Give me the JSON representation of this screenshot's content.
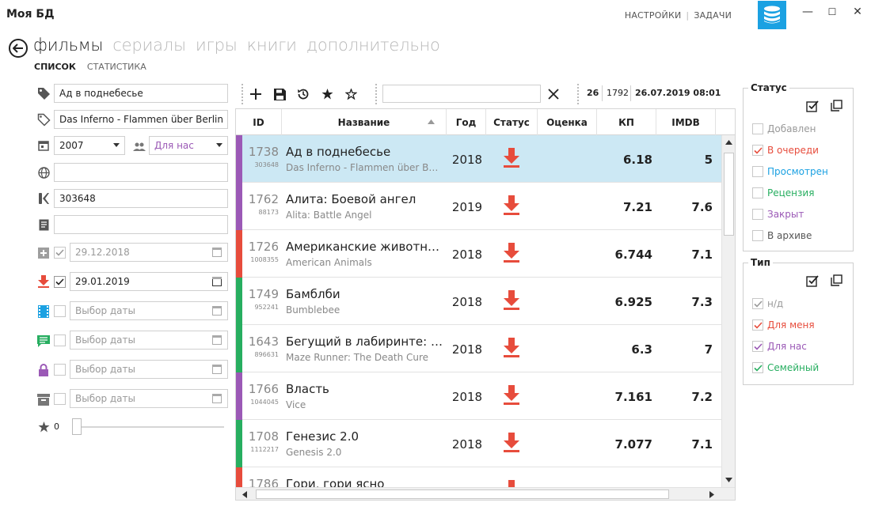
{
  "window": {
    "title": "Моя БД",
    "minimize": "—",
    "maximize": "☐",
    "close": "✕"
  },
  "top_links": {
    "settings": "НАСТРОЙКИ",
    "separator": "|",
    "tasks": "ЗАДАЧИ"
  },
  "nav": {
    "tabs": [
      {
        "label": "фильмы",
        "active": true
      },
      {
        "label": "сериалы",
        "active": false
      },
      {
        "label": "игры",
        "active": false
      },
      {
        "label": "книги",
        "active": false
      },
      {
        "label": "дополнительно",
        "active": false
      }
    ],
    "sub_tabs": [
      {
        "label": "СПИСОК",
        "active": true
      },
      {
        "label": "СТАТИСТИКА",
        "active": false
      }
    ]
  },
  "form": {
    "title_ru": "Ад в поднебесье",
    "title_orig": "Das Inferno - Flammen über Berlin",
    "year": "2007",
    "audience": "Для нас",
    "website": "",
    "kp_id": "303648",
    "notes": "",
    "date_added": "29.12.2018",
    "date_queued": "29.01.2019",
    "date_watched_placeholder": "Выбор даты",
    "date_review_placeholder": "Выбор даты",
    "date_closed_placeholder": "Выбор даты",
    "date_archived_placeholder": "Выбор даты",
    "rating": "0"
  },
  "toolbar": {
    "search_value": "",
    "count_selected": "26",
    "count_total": "1792",
    "last_update": "26.07.2019 08:01"
  },
  "grid": {
    "columns": [
      "ID",
      "Название",
      "Год",
      "Статус",
      "Оценка",
      "КП",
      "IMDB"
    ],
    "rows": [
      {
        "id": "1738",
        "kp_id": "303648",
        "title": "Ад в поднебесье",
        "original": "Das Inferno - Flammen über Berlin",
        "year": "2018",
        "status": "в очереди",
        "rating": "",
        "kp": "6.18",
        "imdb": "5",
        "type_color": "#9b59b6",
        "selected": true
      },
      {
        "id": "1762",
        "kp_id": "88173",
        "title": "Алита: Боевой ангел",
        "original": "Alita: Battle Angel",
        "year": "2019",
        "status": "в очереди",
        "rating": "",
        "kp": "7.21",
        "imdb": "7.6",
        "type_color": "#9b59b6",
        "selected": false
      },
      {
        "id": "1726",
        "kp_id": "1008355",
        "title": "Американские животные",
        "original": "American Animals",
        "year": "2018",
        "status": "в очереди",
        "rating": "",
        "kp": "6.744",
        "imdb": "7.1",
        "type_color": "#e74c3c",
        "selected": false
      },
      {
        "id": "1749",
        "kp_id": "952241",
        "title": "Бамблби",
        "original": "Bumblebee",
        "year": "2018",
        "status": "в очереди",
        "rating": "",
        "kp": "6.925",
        "imdb": "7.3",
        "type_color": "#27ae60",
        "selected": false
      },
      {
        "id": "1643",
        "kp_id": "896631",
        "title": "Бегущий в лабиринте: Лекарство от смерти",
        "original": "Maze Runner: The Death Cure",
        "year": "2018",
        "status": "в очереди",
        "rating": "",
        "kp": "6.3",
        "imdb": "7",
        "type_color": "#27ae60",
        "selected": false
      },
      {
        "id": "1766",
        "kp_id": "1044045",
        "title": "Власть",
        "original": "Vice",
        "year": "2018",
        "status": "в очереди",
        "rating": "",
        "kp": "7.161",
        "imdb": "7.2",
        "type_color": "#9b59b6",
        "selected": false
      },
      {
        "id": "1708",
        "kp_id": "1112217",
        "title": "Генезис 2.0",
        "original": "Genesis 2.0",
        "year": "2018",
        "status": "в очереди",
        "rating": "",
        "kp": "7.077",
        "imdb": "7.1",
        "type_color": "#27ae60",
        "selected": false
      },
      {
        "id": "1786",
        "kp_id": "",
        "title": "Гори, гори ясно",
        "original": "",
        "year": "",
        "status": "в очереди",
        "rating": "",
        "kp": "",
        "imdb": "",
        "type_color": "#e74c3c",
        "selected": false
      }
    ]
  },
  "status_filter": {
    "title": "Статус",
    "items": [
      {
        "label": "Добавлен",
        "checked": false,
        "color": "#999999"
      },
      {
        "label": "В очереди",
        "checked": true,
        "color": "#e74c3c"
      },
      {
        "label": "Просмотрен",
        "checked": false,
        "color": "#1ba1e2"
      },
      {
        "label": "Рецензия",
        "checked": false,
        "color": "#27ae60"
      },
      {
        "label": "Закрыт",
        "checked": false,
        "color": "#9b59b6"
      },
      {
        "label": "В архиве",
        "checked": false,
        "color": "#555555"
      }
    ]
  },
  "type_filter": {
    "title": "Тип",
    "items": [
      {
        "label": "н/д",
        "checked": true,
        "color": "#999999"
      },
      {
        "label": "Для меня",
        "checked": true,
        "color": "#e74c3c"
      },
      {
        "label": "Для нас",
        "checked": true,
        "color": "#9b59b6"
      },
      {
        "label": "Семейный",
        "checked": true,
        "color": "#27ae60"
      }
    ]
  }
}
